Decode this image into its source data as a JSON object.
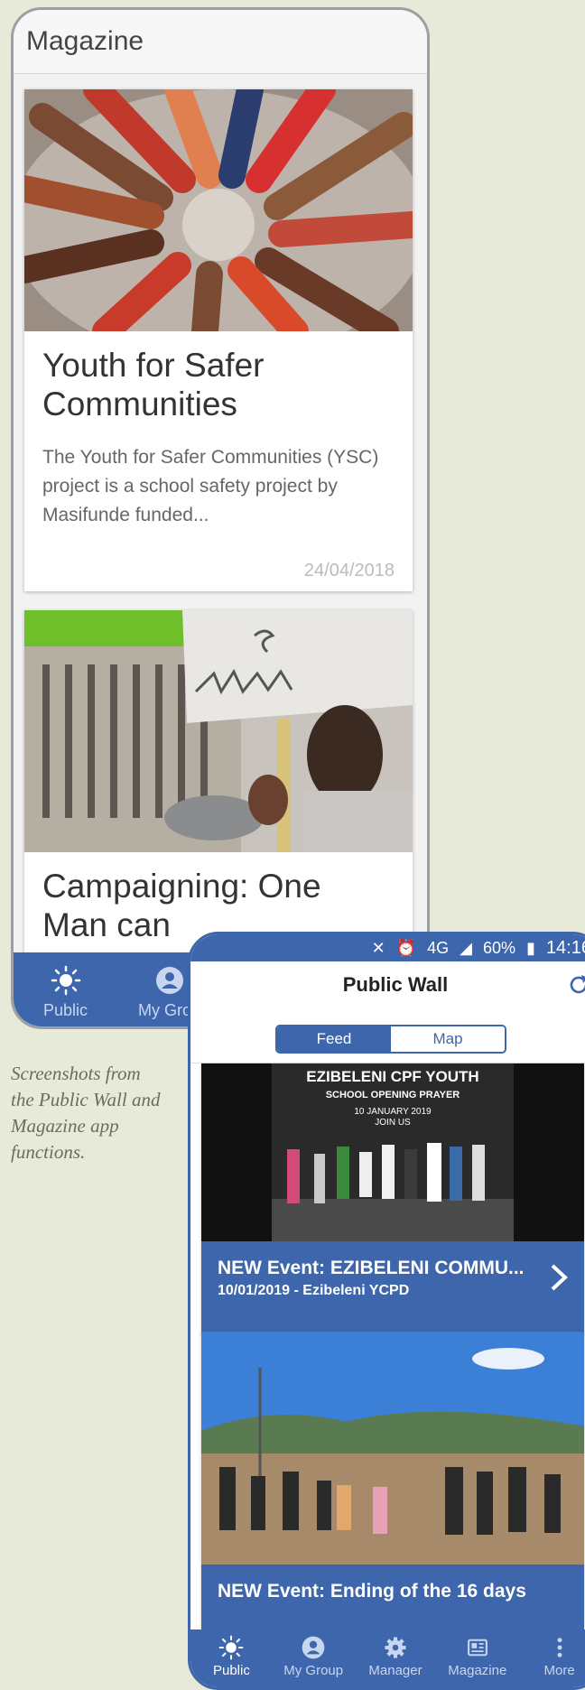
{
  "magazine": {
    "title": "Magazine",
    "articles": [
      {
        "title": "Youth for Safer Communities",
        "description": "The Youth for Safer Communities (YSC) project is a school safety project by Masifunde funded...",
        "date": "24/04/2018"
      },
      {
        "title": "Campaigning: One Man can"
      }
    ],
    "nav": [
      {
        "label": "Public",
        "icon": "sun-icon"
      },
      {
        "label": "My Grou",
        "icon": "user-circle-icon"
      }
    ]
  },
  "caption": "Screenshots from the Public Wall and Magazine app functions.",
  "public_wall": {
    "status": {
      "network": "4G",
      "battery": "60%",
      "time": "14:16"
    },
    "title": "Public Wall",
    "segments": [
      "Feed",
      "Map"
    ],
    "poster": {
      "line1": "EZIBELENI CPF YOUTH",
      "line2": "SCHOOL OPENING PRAYER",
      "line3": "10 JANUARY 2019",
      "line4": "JOIN US"
    },
    "feed": [
      {
        "title": "NEW Event: EZIBELENI COMMU...",
        "subtitle": "10/01/2019 - Ezibeleni YCPD"
      },
      {
        "title": "NEW Event: Ending of the 16 days"
      }
    ],
    "nav": [
      {
        "label": "Public",
        "icon": "sun-icon"
      },
      {
        "label": "My Group",
        "icon": "user-circle-icon"
      },
      {
        "label": "Manager",
        "icon": "gear-icon"
      },
      {
        "label": "Magazine",
        "icon": "newspaper-icon"
      },
      {
        "label": "More",
        "icon": "more-vertical-icon"
      }
    ],
    "accent": "#3d66ac"
  }
}
